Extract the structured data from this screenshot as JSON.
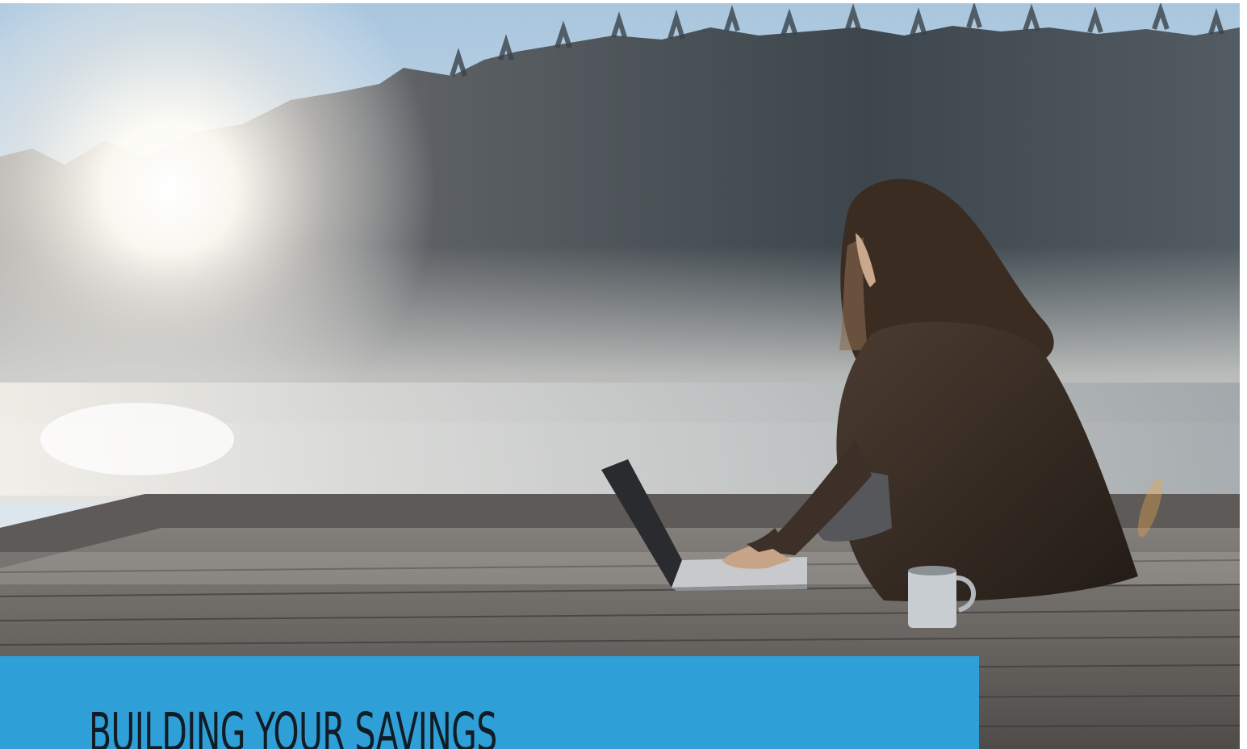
{
  "hero": {
    "image_description_icon": "woman-with-laptop-on-lakeside-dock-photo",
    "colors": {
      "sky": "#c9dbe9",
      "forest": "#3f4a50",
      "mist": "#d8dadb",
      "deck": "#6f6c69",
      "figure": "#2d241e"
    }
  },
  "banner": {
    "title": "BUILDING YOUR SAVINGS",
    "background": "#2f9fd8",
    "text_color": "#111c24"
  }
}
